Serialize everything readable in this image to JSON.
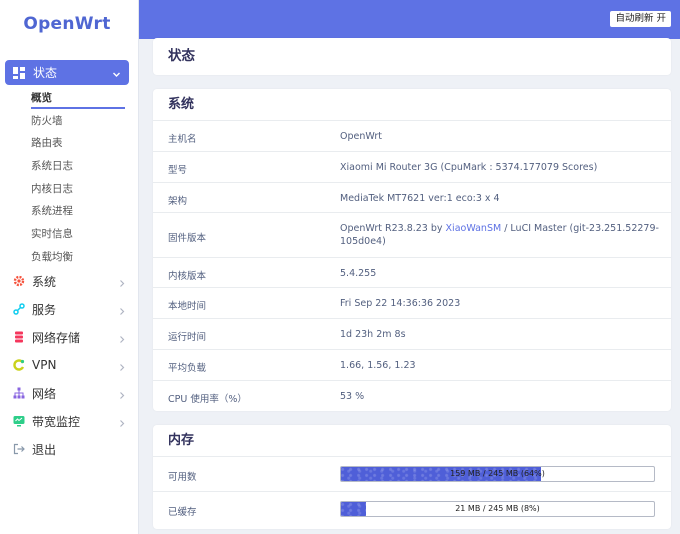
{
  "brand": "OpenWrt",
  "header": {
    "refresh_label": "自动刷新 开"
  },
  "sidebar": {
    "active": {
      "label": "状态",
      "icon": "dashboard-icon"
    },
    "submenu": [
      "概览",
      "防火墙",
      "路由表",
      "系统日志",
      "内核日志",
      "系统进程",
      "实时信息",
      "负载均衡"
    ],
    "items": [
      {
        "label": "系统",
        "icon": "gear-icon",
        "color": "#f5533d"
      },
      {
        "label": "服务",
        "icon": "share-icon",
        "color": "#11cdef"
      },
      {
        "label": "网络存储",
        "icon": "database-icon",
        "color": "#f5365c"
      },
      {
        "label": "VPN",
        "icon": "vpn-icon",
        "color": "#c9d21c"
      },
      {
        "label": "网络",
        "icon": "sitemap-icon",
        "color": "#8965e0"
      },
      {
        "label": "带宽监控",
        "icon": "monitor-icon",
        "color": "#2dce89"
      },
      {
        "label": "退出",
        "icon": "logout-icon",
        "color": "#8898aa"
      }
    ]
  },
  "page_title": "状态",
  "system": {
    "title": "系统",
    "rows": [
      {
        "key": "主机名",
        "value": "OpenWrt"
      },
      {
        "key": "型号",
        "value": "Xiaomi Mi Router 3G (CpuMark : 5374.177079 Scores)"
      },
      {
        "key": "架构",
        "value": "MediaTek MT7621 ver:1 eco:3 x 4"
      },
      {
        "key": "固件版本",
        "value_pre": "OpenWrt R23.8.23 by ",
        "value_link": "XiaoWanSM",
        "value_post": " / LuCI Master (git-23.251.52279-105d0e4)"
      },
      {
        "key": "内核版本",
        "value": "5.4.255"
      },
      {
        "key": "本地时间",
        "value": "Fri Sep 22 14:36:36 2023"
      },
      {
        "key": "运行时间",
        "value": "1d 23h 2m 8s"
      },
      {
        "key": "平均负载",
        "value": "1.66, 1.56, 1.23"
      },
      {
        "key": "CPU 使用率（%）",
        "value": "53 %"
      }
    ]
  },
  "memory": {
    "title": "内存",
    "rows": [
      {
        "key": "可用数",
        "bar_text": "159 MB / 245 MB (64%)",
        "fraction": 0.64
      },
      {
        "key": "已缓存",
        "bar_text": "21 MB / 245 MB (8%)",
        "fraction": 0.08
      }
    ]
  }
}
